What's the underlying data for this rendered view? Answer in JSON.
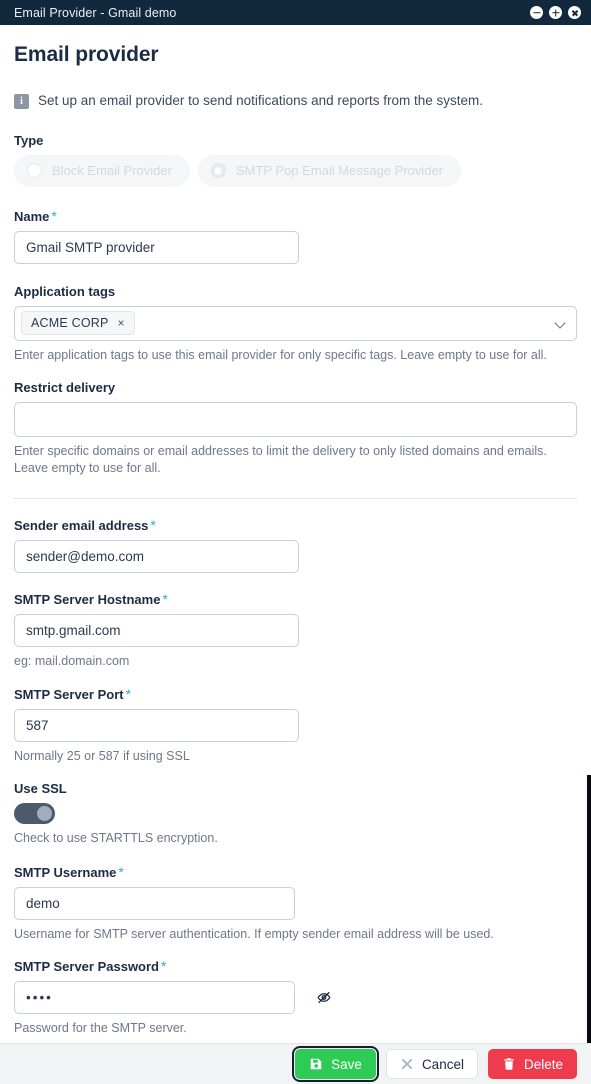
{
  "window": {
    "title": "Email Provider - Gmail demo",
    "controls": [
      {
        "name": "minimize",
        "glyph": "minus"
      },
      {
        "name": "maximize",
        "glyph": "plus"
      },
      {
        "name": "close",
        "glyph": "cross"
      }
    ]
  },
  "page": {
    "heading": "Email provider",
    "info_icon": "i",
    "info_text": "Set up an email provider to send notifications and reports from the system."
  },
  "type": {
    "label": "Type",
    "options": [
      {
        "label": "Block Email Provider",
        "selected": false,
        "disabled": true
      },
      {
        "label": "SMTP Pop Email Message Provider",
        "selected": true,
        "disabled": true
      }
    ]
  },
  "name_field": {
    "label": "Name",
    "required": "*",
    "value": "Gmail SMTP provider",
    "placeholder": ""
  },
  "application_tags": {
    "label": "Application tags",
    "tags": [
      "ACME CORP"
    ],
    "remove_glyph": "×",
    "helper": "Enter application tags to use this email provider for only specific tags. Leave empty to use for all."
  },
  "restrict_delivery": {
    "label": "Restrict delivery",
    "value": "",
    "placeholder": "",
    "helper": "Enter specific domains or email addresses to limit the delivery to only listed domains and emails. Leave empty to use for all."
  },
  "sender_email": {
    "label": "Sender email address",
    "required": "*",
    "value": "sender@demo.com",
    "placeholder": ""
  },
  "smtp_hostname": {
    "label": "SMTP Server Hostname",
    "required": "*",
    "value": "smtp.gmail.com",
    "placeholder": "",
    "helper": "eg: mail.domain.com"
  },
  "smtp_port": {
    "label": "SMTP Server Port",
    "required": "*",
    "value": "587",
    "placeholder": "",
    "helper": "Normally 25 or 587 if using SSL"
  },
  "use_ssl": {
    "label": "Use SSL",
    "checked": true,
    "helper": "Check to use STARTTLS encryption."
  },
  "smtp_username": {
    "label": "SMTP Username",
    "required": "*",
    "value": "demo",
    "placeholder": "",
    "helper": "Username for SMTP server authentication. If empty sender email address will be used."
  },
  "smtp_password": {
    "label": "SMTP Server Password",
    "required": "*",
    "value": "••••",
    "placeholder": "",
    "helper": "Password for the SMTP server.",
    "reveal_icon": "eye-off-icon"
  },
  "footer": {
    "save_label": "Save",
    "cancel_label": "Cancel",
    "delete_label": "Delete"
  },
  "colors": {
    "titlebar_bg": "#12283c",
    "accent_required": "#2aa9e0",
    "save_green": "#2ecc55",
    "delete_red": "#ef3b4e",
    "toggle_on": "#4c5a6e",
    "heading": "#1b2c45"
  }
}
